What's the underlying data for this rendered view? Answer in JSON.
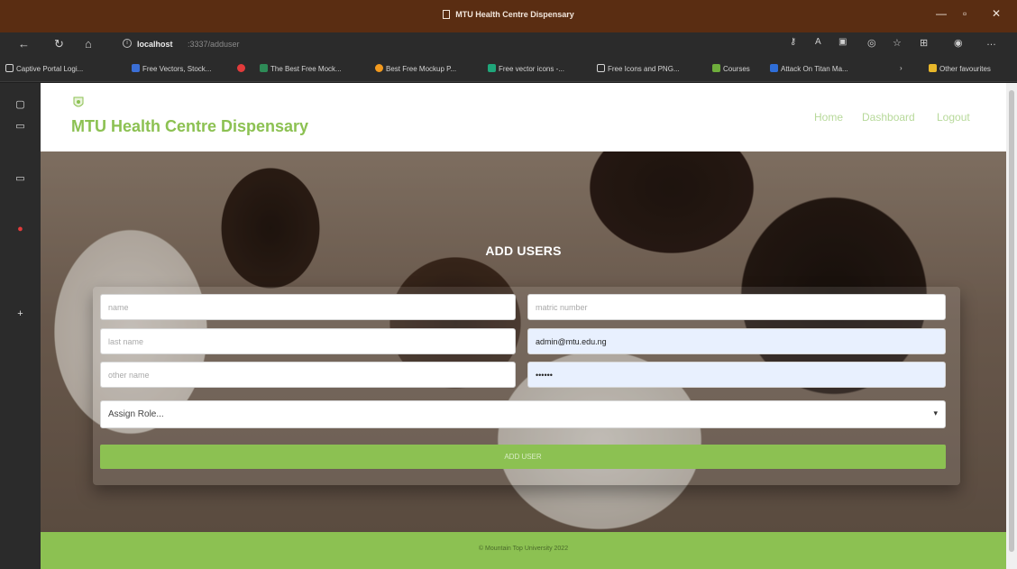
{
  "window": {
    "title": "MTU Health Centre Dispensary",
    "minimize": "—",
    "maximize": "▫",
    "close": "✕"
  },
  "browser": {
    "url_host": "localhost",
    "url_path": ":3337/adduser",
    "bookmarks": [
      {
        "label": "Captive Portal Logi...",
        "color": "#d4d4d4"
      },
      {
        "label": "Free Vectors, Stock...",
        "color": "#3b6fd6"
      },
      {
        "label": "",
        "color": "#e23b3b"
      },
      {
        "label": "The Best Free Mock...",
        "color": "#2e8b57"
      },
      {
        "label": "Best Free Mockup P...",
        "color": "#f39a1e"
      },
      {
        "label": "Free vector icons -...",
        "color": "#1fa67a"
      },
      {
        "label": "Free Icons and PNG...",
        "color": "#d4d4d4"
      },
      {
        "label": "Courses",
        "color": "#6fae3c"
      },
      {
        "label": "Attack On Titan Ma...",
        "color": "#2f6ed8"
      },
      {
        "label": "Other favourites",
        "color": "#e8b72a"
      }
    ]
  },
  "site": {
    "brand": "MTU Health Centre Dispensary",
    "nav": {
      "home": "Home",
      "dashboard": "Dashboard",
      "logout": "Logout"
    }
  },
  "form": {
    "title": "ADD USERS",
    "fields": {
      "name": {
        "placeholder": "name",
        "value": ""
      },
      "matric": {
        "placeholder": "matric number",
        "value": ""
      },
      "last_name": {
        "placeholder": "last name",
        "value": ""
      },
      "email": {
        "placeholder": "",
        "value": "admin@mtu.edu.ng"
      },
      "other_name": {
        "placeholder": "other name",
        "value": ""
      },
      "password": {
        "placeholder": "",
        "value": "••••••"
      }
    },
    "role_select": "Assign Role...",
    "submit": "ADD USER"
  },
  "footer": {
    "text": "© Mountain Top University 2022"
  },
  "colors": {
    "accent": "#8cc152",
    "titlebar": "#5a2d12"
  }
}
